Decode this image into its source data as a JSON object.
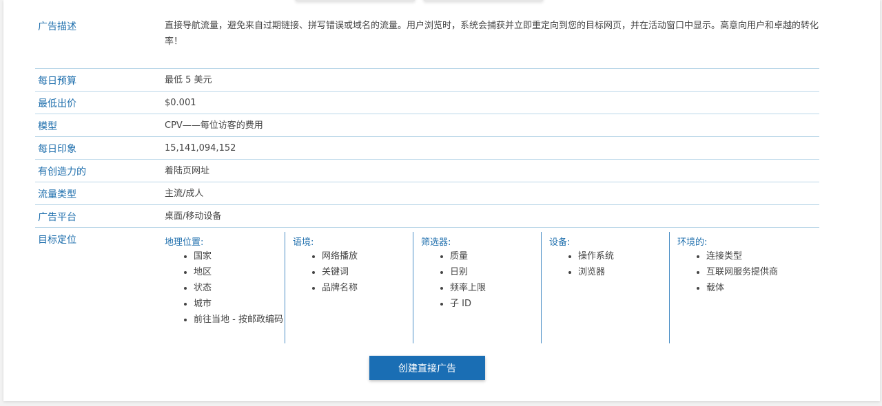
{
  "rows": {
    "description": {
      "label": "广告描述",
      "value": "直接导航流量，避免来自过期链接、拼写错误或域名的流量。用户浏览时，系统会捕获并立即重定向到您的目标网页，并在活动窗口中显示。高意向用户和卓越的转化率！"
    },
    "daily_budget": {
      "label": "每日预算",
      "value": "最低 5 美元"
    },
    "min_bid": {
      "label": "最低出价",
      "value": "$0.001"
    },
    "model": {
      "label": "模型",
      "value": "CPV——每位访客的费用"
    },
    "daily_impressions": {
      "label": "每日印象",
      "value": "15,141,094,152"
    },
    "creative": {
      "label": "有创造力的",
      "value": "着陆页网址"
    },
    "traffic_type": {
      "label": "流量类型",
      "value": "主流/成人"
    },
    "ad_platform": {
      "label": "广告平台",
      "value": "桌面/移动设备"
    },
    "targeting": {
      "label": "目标定位",
      "columns": [
        {
          "title": "地理位置:",
          "items": [
            "国家",
            "地区",
            "状态",
            "城市",
            "前往当地 - 按邮政编码"
          ]
        },
        {
          "title": "语境:",
          "items": [
            "网络播放",
            "关键词",
            "品牌名称"
          ]
        },
        {
          "title": "筛选器:",
          "items": [
            "质量",
            "日别",
            "频率上限",
            "子 ID"
          ]
        },
        {
          "title": "设备:",
          "items": [
            "操作系统",
            "浏览器"
          ]
        },
        {
          "title": "环境的:",
          "items": [
            "连接类型",
            "互联网服务提供商",
            "载体"
          ]
        }
      ]
    }
  },
  "cta": {
    "label": "创建直接广告"
  },
  "colors": {
    "accent": "#1a6eb4",
    "label": "#1f6fad",
    "divider": "#b9d6e8"
  }
}
